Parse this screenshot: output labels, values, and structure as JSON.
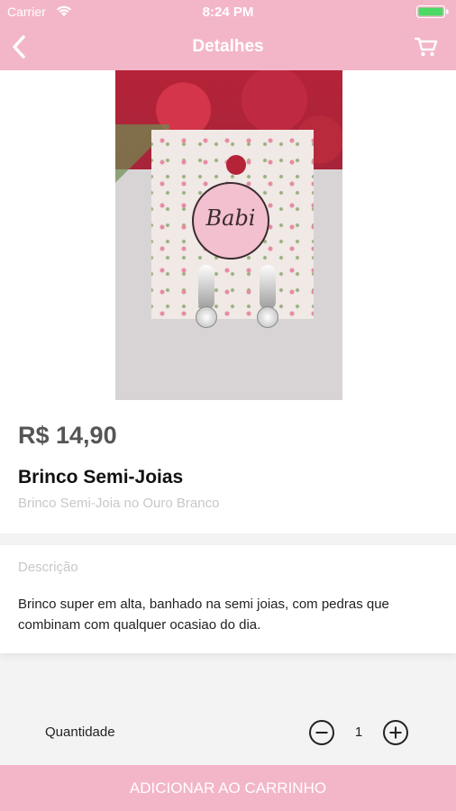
{
  "status_bar": {
    "carrier": "Carrier",
    "time": "8:24 PM"
  },
  "nav": {
    "title": "Detalhes",
    "back_icon": "chevron-left-icon",
    "cart_icon": "cart-icon"
  },
  "product": {
    "image_logo_text": "Babi",
    "price": "R$ 14,90",
    "name": "Brinco Semi-Joias",
    "subtitle": "Brinco Semi-Joia no Ouro Branco"
  },
  "description": {
    "label": "Descrição",
    "text": "Brinco super em alta, banhado na semi joias, com pedras que combinam com qualquer ocasiao do dia."
  },
  "quantity": {
    "label": "Quantidade",
    "value": "1"
  },
  "actions": {
    "add_to_cart_label": "ADICIONAR AO CARRINHO"
  },
  "colors": {
    "accent": "#f3b6c9",
    "text_primary": "#111111",
    "text_muted": "#c8c8c8"
  }
}
